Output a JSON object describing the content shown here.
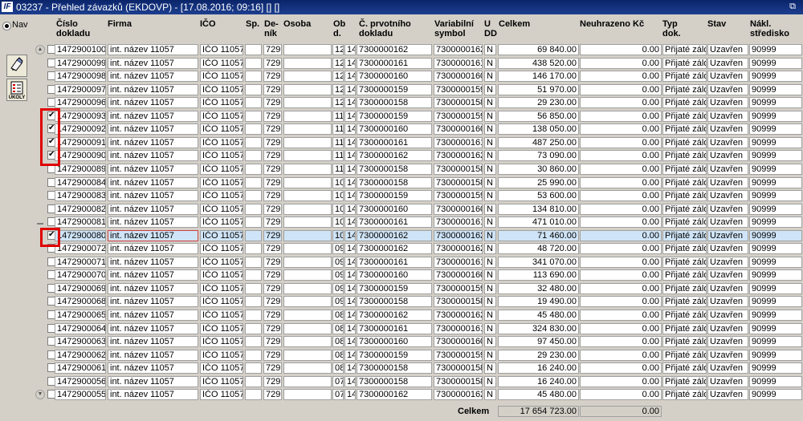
{
  "window": {
    "title": "03237 - Přehled závazků (EKDOVP) - [17.08.2016; 09:16] [] []",
    "app_icon": "IF",
    "restore_icon": "⧉"
  },
  "nav": {
    "label": "Nav",
    "tools": [
      {
        "icon": "hand-pen-icon"
      },
      {
        "icon": "tasks-icon",
        "label": "ÚKOLY"
      }
    ]
  },
  "columns": {
    "cislo": "Číslo\ndokladu",
    "firma": "Firma",
    "ico": "IČO",
    "sp": "Sp.",
    "denik": "De-\nník",
    "osoba": "Osoba",
    "obd": "Ob\nd.",
    "prvotni": "Č. prvotního\ndokladu",
    "vs": "Variabilní\nsymbol",
    "udd": "U\nDD",
    "celkem": "Celkem",
    "neuhrazeno": "Neuhrazeno Kč",
    "typ": "Typ\ndok.",
    "stav": "Stav",
    "stredisko": "Nákl.\nstředisko"
  },
  "rows": [
    {
      "checked": false,
      "cislo": "1472900100",
      "firma": "int. název 11057",
      "ico": "IČO 11057",
      "sp": "",
      "denik": "729",
      "osoba": "",
      "o1": "12",
      "o2": "14",
      "prvotni": "7300000162",
      "vs": "7300000162",
      "udd": "N",
      "celkem": "69 840.00",
      "neuhrazeno": "0.00",
      "typ": "Přijaté záloh",
      "stav": "Uzavřen",
      "stredisko": "90999"
    },
    {
      "checked": false,
      "cislo": "1472900099",
      "firma": "int. název 11057",
      "ico": "IČO 11057",
      "sp": "",
      "denik": "729",
      "osoba": "",
      "o1": "12",
      "o2": "14",
      "prvotni": "7300000161",
      "vs": "7300000161",
      "udd": "N",
      "celkem": "438 520.00",
      "neuhrazeno": "0.00",
      "typ": "Přijaté záloh",
      "stav": "Uzavřen",
      "stredisko": "90999"
    },
    {
      "checked": false,
      "cislo": "1472900098",
      "firma": "int. název 11057",
      "ico": "IČO 11057",
      "sp": "",
      "denik": "729",
      "osoba": "",
      "o1": "12",
      "o2": "14",
      "prvotni": "7300000160",
      "vs": "7300000160",
      "udd": "N",
      "celkem": "146 170.00",
      "neuhrazeno": "0.00",
      "typ": "Přijaté záloh",
      "stav": "Uzavřen",
      "stredisko": "90999"
    },
    {
      "checked": false,
      "cislo": "1472900097",
      "firma": "int. název 11057",
      "ico": "IČO 11057",
      "sp": "",
      "denik": "729",
      "osoba": "",
      "o1": "12",
      "o2": "14",
      "prvotni": "7300000159",
      "vs": "7300000159",
      "udd": "N",
      "celkem": "51 970.00",
      "neuhrazeno": "0.00",
      "typ": "Přijaté záloh",
      "stav": "Uzavřen",
      "stredisko": "90999"
    },
    {
      "checked": false,
      "cislo": "1472900096",
      "firma": "int. název 11057",
      "ico": "IČO 11057",
      "sp": "",
      "denik": "729",
      "osoba": "",
      "o1": "12",
      "o2": "14",
      "prvotni": "7300000158",
      "vs": "7300000158",
      "udd": "N",
      "celkem": "29 230.00",
      "neuhrazeno": "0.00",
      "typ": "Přijaté záloh",
      "stav": "Uzavřen",
      "stredisko": "90999"
    },
    {
      "checked": true,
      "cislo": "1472900093",
      "firma": "int. název 11057",
      "ico": "IČO 11057",
      "sp": "",
      "denik": "729",
      "osoba": "",
      "o1": "11",
      "o2": "14",
      "prvotni": "7300000159",
      "vs": "7300000159",
      "udd": "N",
      "celkem": "56 850.00",
      "neuhrazeno": "0.00",
      "typ": "Přijaté záloh",
      "stav": "Uzavřen",
      "stredisko": "90999"
    },
    {
      "checked": true,
      "cislo": "1472900092",
      "firma": "int. název 11057",
      "ico": "IČO 11057",
      "sp": "",
      "denik": "729",
      "osoba": "",
      "o1": "11",
      "o2": "14",
      "prvotni": "7300000160",
      "vs": "7300000160",
      "udd": "N",
      "celkem": "138 050.00",
      "neuhrazeno": "0.00",
      "typ": "Přijaté záloh",
      "stav": "Uzavřen",
      "stredisko": "90999"
    },
    {
      "checked": true,
      "cislo": "1472900091",
      "firma": "int. název 11057",
      "ico": "IČO 11057",
      "sp": "",
      "denik": "729",
      "osoba": "",
      "o1": "11",
      "o2": "14",
      "prvotni": "7300000161",
      "vs": "7300000161",
      "udd": "N",
      "celkem": "487 250.00",
      "neuhrazeno": "0.00",
      "typ": "Přijaté záloh",
      "stav": "Uzavřen",
      "stredisko": "90999"
    },
    {
      "checked": true,
      "cislo": "1472900090",
      "firma": "int. název 11057",
      "ico": "IČO 11057",
      "sp": "",
      "denik": "729",
      "osoba": "",
      "o1": "11",
      "o2": "14",
      "prvotni": "7300000162",
      "vs": "7300000162",
      "udd": "N",
      "celkem": "73 090.00",
      "neuhrazeno": "0.00",
      "typ": "Přijaté záloh",
      "stav": "Uzavřen",
      "stredisko": "90999"
    },
    {
      "checked": false,
      "cislo": "1472900089",
      "firma": "int. název 11057",
      "ico": "IČO 11057",
      "sp": "",
      "denik": "729",
      "osoba": "",
      "o1": "11",
      "o2": "14",
      "prvotni": "7300000158",
      "vs": "7300000158",
      "udd": "N",
      "celkem": "30 860.00",
      "neuhrazeno": "0.00",
      "typ": "Přijaté záloh",
      "stav": "Uzavřen",
      "stredisko": "90999"
    },
    {
      "checked": false,
      "cislo": "1472900084",
      "firma": "int. název 11057",
      "ico": "IČO 11057",
      "sp": "",
      "denik": "729",
      "osoba": "",
      "o1": "10",
      "o2": "14",
      "prvotni": "7300000158",
      "vs": "7300000158",
      "udd": "N",
      "celkem": "25 990.00",
      "neuhrazeno": "0.00",
      "typ": "Přijaté záloh",
      "stav": "Uzavřen",
      "stredisko": "90999"
    },
    {
      "checked": false,
      "cislo": "1472900083",
      "firma": "int. název 11057",
      "ico": "IČO 11057",
      "sp": "",
      "denik": "729",
      "osoba": "",
      "o1": "10",
      "o2": "14",
      "prvotni": "7300000159",
      "vs": "7300000159",
      "udd": "N",
      "celkem": "53 600.00",
      "neuhrazeno": "0.00",
      "typ": "Přijaté záloh",
      "stav": "Uzavřen",
      "stredisko": "90999"
    },
    {
      "checked": false,
      "cislo": "1472900082",
      "firma": "int. název 11057",
      "ico": "IČO 11057",
      "sp": "",
      "denik": "729",
      "osoba": "",
      "o1": "10",
      "o2": "14",
      "prvotni": "7300000160",
      "vs": "7300000160",
      "udd": "N",
      "celkem": "134 810.00",
      "neuhrazeno": "0.00",
      "typ": "Přijaté záloh",
      "stav": "Uzavřen",
      "stredisko": "90999"
    },
    {
      "checked": false,
      "cislo": "1472900081",
      "firma": "int. název 11057",
      "ico": "IČO 11057",
      "sp": "",
      "denik": "729",
      "osoba": "",
      "o1": "10",
      "o2": "14",
      "prvotni": "7300000161",
      "vs": "7300000161",
      "udd": "N",
      "celkem": "471 010.00",
      "neuhrazeno": "0.00",
      "typ": "Přijaté záloh",
      "stav": "Uzavřen",
      "stredisko": "90999"
    },
    {
      "checked": true,
      "selected": true,
      "cislo": "1472900080",
      "firma": "int. název 11057",
      "ico": "IČO 11057",
      "sp": "",
      "denik": "729",
      "osoba": "",
      "o1": "10",
      "o2": "14",
      "prvotni": "7300000162",
      "vs": "7300000162",
      "udd": "N",
      "celkem": "71 460.00",
      "neuhrazeno": "0.00",
      "typ": "Přijaté záloh",
      "stav": "Uzavřen",
      "stredisko": "90999"
    },
    {
      "checked": false,
      "cislo": "1472900072",
      "firma": "int. název 11057",
      "ico": "IČO 11057",
      "sp": "",
      "denik": "729",
      "osoba": "",
      "o1": "09",
      "o2": "14",
      "prvotni": "7300000162",
      "vs": "7300000162",
      "udd": "N",
      "celkem": "48 720.00",
      "neuhrazeno": "0.00",
      "typ": "Přijaté záloh",
      "stav": "Uzavřen",
      "stredisko": "90999"
    },
    {
      "checked": false,
      "cislo": "1472900071",
      "firma": "int. název 11057",
      "ico": "IČO 11057",
      "sp": "",
      "denik": "729",
      "osoba": "",
      "o1": "09",
      "o2": "14",
      "prvotni": "7300000161",
      "vs": "7300000161",
      "udd": "N",
      "celkem": "341 070.00",
      "neuhrazeno": "0.00",
      "typ": "Přijaté záloh",
      "stav": "Uzavřen",
      "stredisko": "90999"
    },
    {
      "checked": false,
      "cislo": "1472900070",
      "firma": "int. název 11057",
      "ico": "IČO 11057",
      "sp": "",
      "denik": "729",
      "osoba": "",
      "o1": "09",
      "o2": "14",
      "prvotni": "7300000160",
      "vs": "7300000160",
      "udd": "N",
      "celkem": "113 690.00",
      "neuhrazeno": "0.00",
      "typ": "Přijaté záloh",
      "stav": "Uzavřen",
      "stredisko": "90999"
    },
    {
      "checked": false,
      "cislo": "1472900069",
      "firma": "int. název 11057",
      "ico": "IČO 11057",
      "sp": "",
      "denik": "729",
      "osoba": "",
      "o1": "09",
      "o2": "14",
      "prvotni": "7300000159",
      "vs": "7300000159",
      "udd": "N",
      "celkem": "32 480.00",
      "neuhrazeno": "0.00",
      "typ": "Přijaté záloh",
      "stav": "Uzavřen",
      "stredisko": "90999"
    },
    {
      "checked": false,
      "cislo": "1472900068",
      "firma": "int. název 11057",
      "ico": "IČO 11057",
      "sp": "",
      "denik": "729",
      "osoba": "",
      "o1": "09",
      "o2": "14",
      "prvotni": "7300000158",
      "vs": "7300000158",
      "udd": "N",
      "celkem": "19 490.00",
      "neuhrazeno": "0.00",
      "typ": "Přijaté záloh",
      "stav": "Uzavřen",
      "stredisko": "90999"
    },
    {
      "checked": false,
      "cislo": "1472900065",
      "firma": "int. název 11057",
      "ico": "IČO 11057",
      "sp": "",
      "denik": "729",
      "osoba": "",
      "o1": "08",
      "o2": "14",
      "prvotni": "7300000162",
      "vs": "7300000162",
      "udd": "N",
      "celkem": "45 480.00",
      "neuhrazeno": "0.00",
      "typ": "Přijaté záloh",
      "stav": "Uzavřen",
      "stredisko": "90999"
    },
    {
      "checked": false,
      "cislo": "1472900064",
      "firma": "int. název 11057",
      "ico": "IČO 11057",
      "sp": "",
      "denik": "729",
      "osoba": "",
      "o1": "08",
      "o2": "14",
      "prvotni": "7300000161",
      "vs": "7300000161",
      "udd": "N",
      "celkem": "324 830.00",
      "neuhrazeno": "0.00",
      "typ": "Přijaté záloh",
      "stav": "Uzavřen",
      "stredisko": "90999"
    },
    {
      "checked": false,
      "cislo": "1472900063",
      "firma": "int. název 11057",
      "ico": "IČO 11057",
      "sp": "",
      "denik": "729",
      "osoba": "",
      "o1": "08",
      "o2": "14",
      "prvotni": "7300000160",
      "vs": "7300000160",
      "udd": "N",
      "celkem": "97 450.00",
      "neuhrazeno": "0.00",
      "typ": "Přijaté záloh",
      "stav": "Uzavřen",
      "stredisko": "90999"
    },
    {
      "checked": false,
      "cislo": "1472900062",
      "firma": "int. název 11057",
      "ico": "IČO 11057",
      "sp": "",
      "denik": "729",
      "osoba": "",
      "o1": "08",
      "o2": "14",
      "prvotni": "7300000159",
      "vs": "7300000159",
      "udd": "N",
      "celkem": "29 230.00",
      "neuhrazeno": "0.00",
      "typ": "Přijaté záloh",
      "stav": "Uzavřen",
      "stredisko": "90999"
    },
    {
      "checked": false,
      "cislo": "1472900061",
      "firma": "int. název 11057",
      "ico": "IČO 11057",
      "sp": "",
      "denik": "729",
      "osoba": "",
      "o1": "08",
      "o2": "14",
      "prvotni": "7300000158",
      "vs": "7300000158",
      "udd": "N",
      "celkem": "16 240.00",
      "neuhrazeno": "0.00",
      "typ": "Přijaté záloh",
      "stav": "Uzavřen",
      "stredisko": "90999"
    },
    {
      "checked": false,
      "cislo": "1472900056",
      "firma": "int. název 11057",
      "ico": "IČO 11057",
      "sp": "",
      "denik": "729",
      "osoba": "",
      "o1": "07",
      "o2": "14",
      "prvotni": "7300000158",
      "vs": "7300000158",
      "udd": "N",
      "celkem": "16 240.00",
      "neuhrazeno": "0.00",
      "typ": "Přijaté záloh",
      "stav": "Uzavřen",
      "stredisko": "90999"
    },
    {
      "checked": false,
      "cislo": "1472900055",
      "firma": "int. název 11057",
      "ico": "IČO 11057",
      "sp": "",
      "denik": "729",
      "osoba": "",
      "o1": "07",
      "o2": "14",
      "prvotni": "7300000162",
      "vs": "7300000162",
      "udd": "N",
      "celkem": "45 480.00",
      "neuhrazeno": "0.00",
      "typ": "Přijaté záloh",
      "stav": "Uzavřen",
      "stredisko": "90999"
    }
  ],
  "totals": {
    "label": "Celkem",
    "celkem": "17 654 723.00",
    "neuhrazeno": "0.00"
  },
  "colors": {
    "titlebar": "#0a246a",
    "selected_row": "#cfe4f7",
    "highlight": "#e00000"
  }
}
